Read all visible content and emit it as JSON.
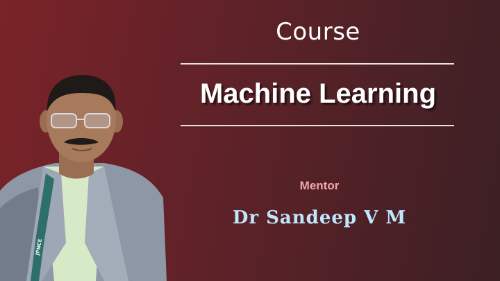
{
  "slide": {
    "course_label": "Course",
    "course_title": "Machine Learning",
    "mentor_label": "Mentor",
    "mentor_name": "Dr Sandeep V M",
    "lanyard_text": "JPNCE"
  },
  "colors": {
    "background_left": "#7a2328",
    "background_right": "#3c2024",
    "mentor_label": "#f4a6a8",
    "mentor_name": "#bfe8ff",
    "title": "#ffffff"
  }
}
